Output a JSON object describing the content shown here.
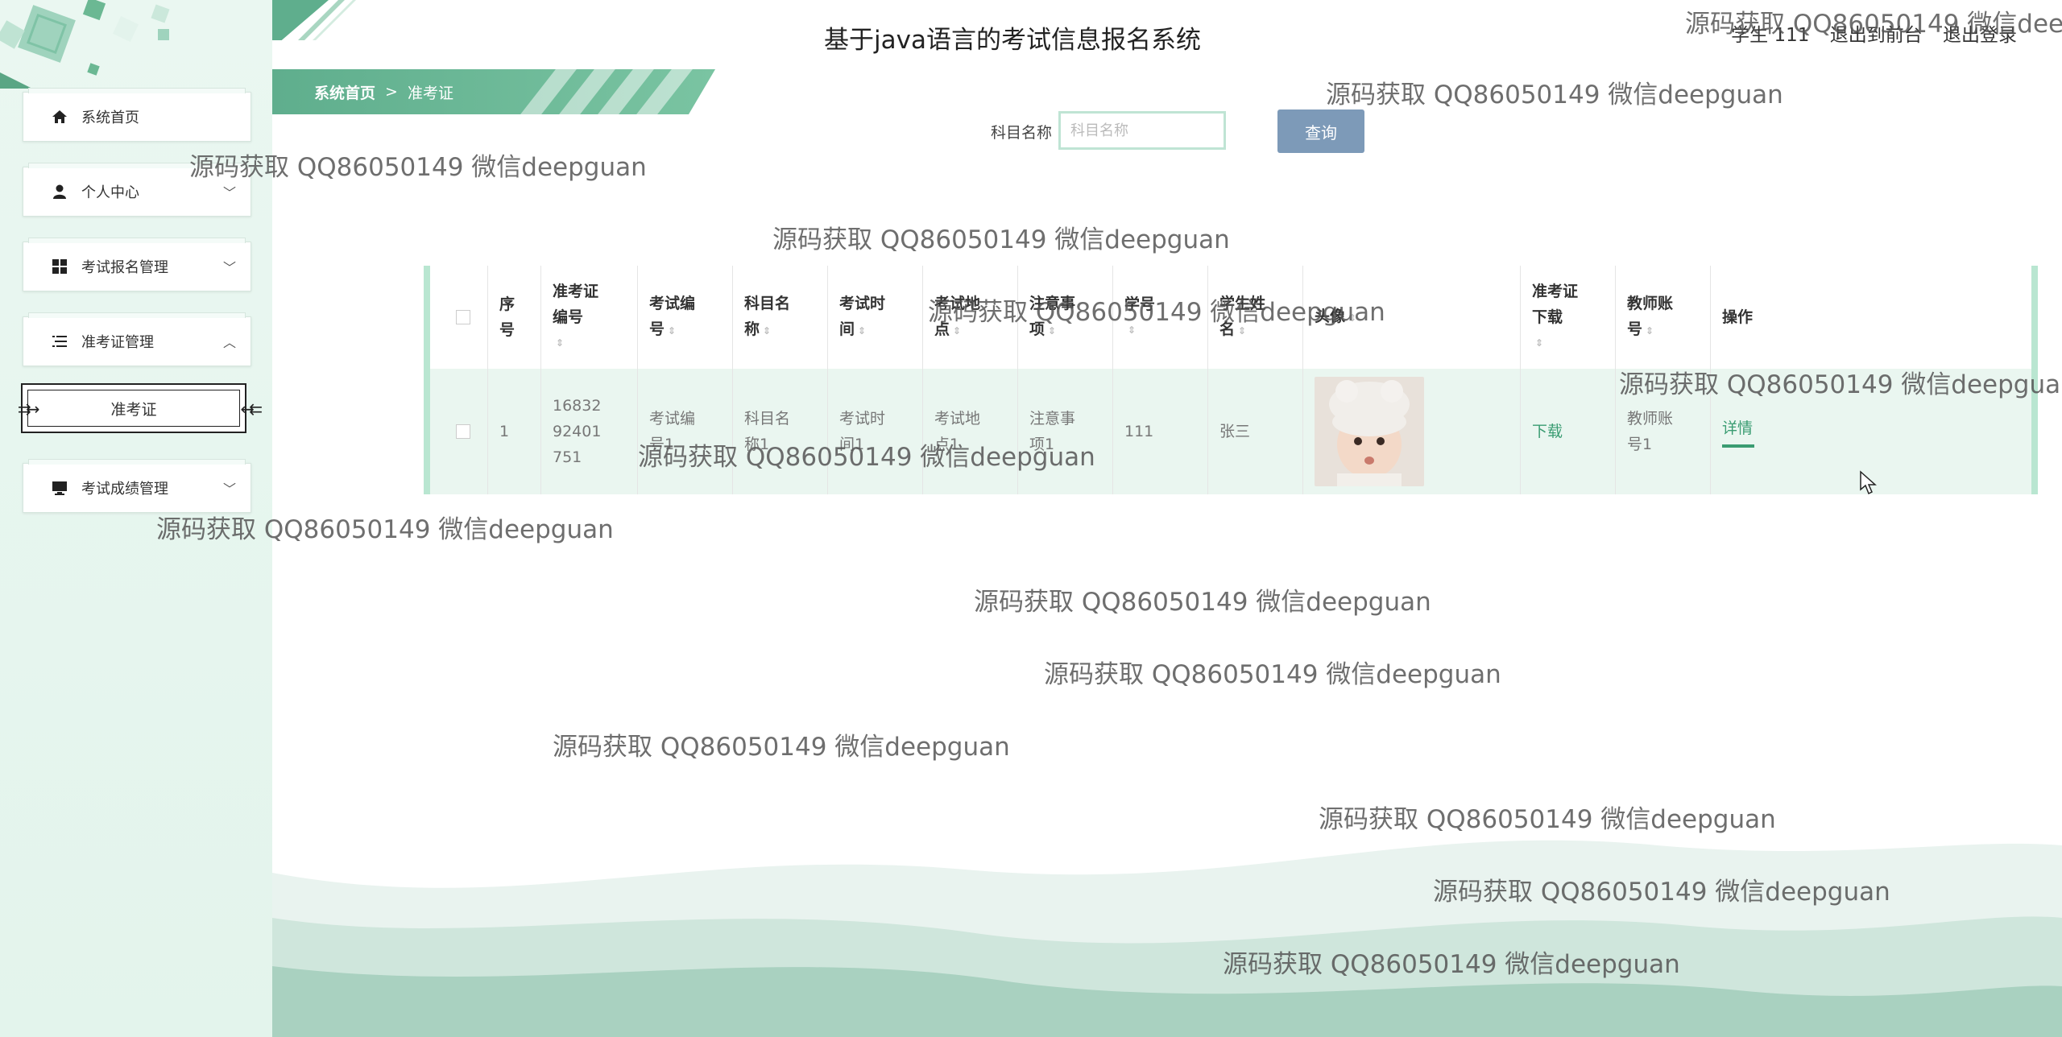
{
  "header": {
    "title": "基于java语言的考试信息报名系统",
    "user_label": "学生 111",
    "front_link": "退出到前台",
    "logout_link": "退出登录"
  },
  "sidebar": {
    "items": [
      {
        "label": "系统首页",
        "icon": "home-icon"
      },
      {
        "label": "个人中心",
        "icon": "user-icon"
      },
      {
        "label": "考试报名管理",
        "icon": "grid-icon"
      },
      {
        "label": "准考证管理",
        "icon": "list-icon"
      },
      {
        "label": "考试成绩管理",
        "icon": "monitor-icon"
      }
    ],
    "sub_item": "准考证"
  },
  "breadcrumb": {
    "home": "系统首页",
    "separator": ">",
    "current": "准考证"
  },
  "search": {
    "label": "科目名称",
    "placeholder": "科目名称",
    "button": "查询"
  },
  "table": {
    "headers": {
      "index": [
        "序",
        "号"
      ],
      "ticket_no": [
        "准考证",
        "编号"
      ],
      "exam_no": [
        "考试编",
        "号"
      ],
      "subject": [
        "科目名",
        "称"
      ],
      "time": [
        "考试时",
        "间"
      ],
      "place": [
        "考试地",
        "点"
      ],
      "notes": [
        "注意事",
        "项"
      ],
      "student_no": "学号",
      "student_name": [
        "学生姓",
        "名"
      ],
      "avatar": "头像",
      "download": [
        "准考证",
        "下载"
      ],
      "teacher": [
        "教师账",
        "号"
      ],
      "action": "操作"
    },
    "rows": [
      {
        "index": "1",
        "ticket_no": [
          "16832",
          "92401",
          "751"
        ],
        "exam_no": [
          "考试编",
          "号1"
        ],
        "subject": [
          "科目名",
          "称1"
        ],
        "time": [
          "考试时",
          "间1"
        ],
        "place": [
          "考试地",
          "点1"
        ],
        "notes": [
          "注意事",
          "项1"
        ],
        "student_no": "111",
        "student_name": "张三",
        "download": "下载",
        "teacher": [
          "教师账",
          "号1"
        ],
        "action": "详情"
      }
    ]
  },
  "watermark": "源码获取 QQ86050149 微信deepguan",
  "colors": {
    "accent": "#5fae8d",
    "button": "#7d9ab8",
    "sidebar_bg": "#e6f5ee"
  }
}
